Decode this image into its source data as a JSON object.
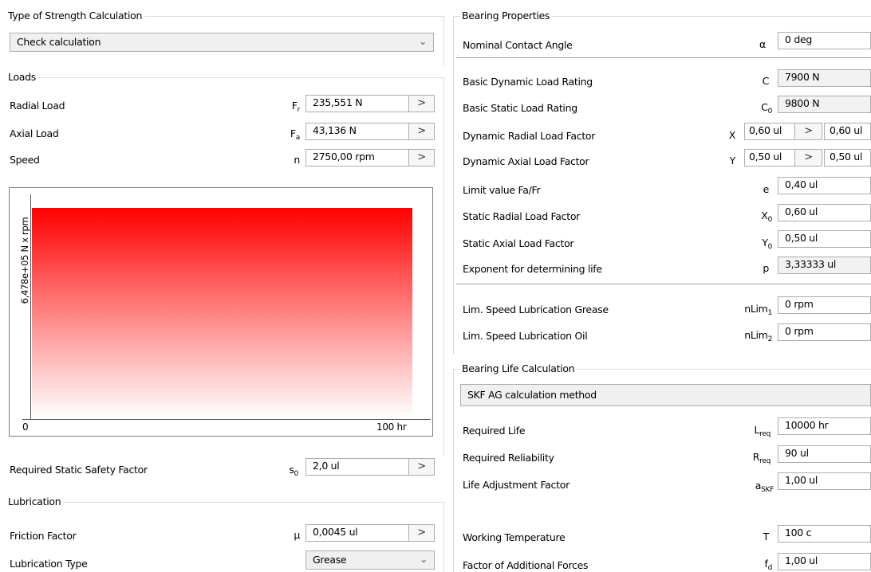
{
  "left": {
    "strength": {
      "title": "Type of Strength Calculation",
      "value": "Check calculation"
    },
    "loads": {
      "title": "Loads",
      "rows": [
        {
          "label": "Radial Load",
          "symbol": "F",
          "sub": "r",
          "value": "235,551 N"
        },
        {
          "label": "Axial Load",
          "symbol": "F",
          "sub": "a",
          "value": "43,136 N"
        },
        {
          "label": "Speed",
          "symbol": "n",
          "sub": "",
          "value": "2750,00 rpm"
        }
      ],
      "arrow": ">"
    },
    "chart": {
      "ylabel": "6,478e+05 N x rpm",
      "x_start": "0",
      "x_end": "100 hr"
    },
    "static_safety": {
      "label": "Required Static Safety Factor",
      "symbol": "s",
      "sub": "0",
      "value": "2,0 ul"
    },
    "lubrication": {
      "title": "Lubrication",
      "friction": {
        "label": "Friction Factor",
        "symbol": "μ",
        "value": "0,0045 ul"
      },
      "type": {
        "label": "Lubrication Type",
        "value": "Grease"
      }
    }
  },
  "right": {
    "bearing": {
      "title": "Bearing Properties",
      "contact": {
        "label": "Nominal Contact Angle",
        "symbol": "α",
        "value": "0 deg"
      },
      "dyn_rating": {
        "label": "Basic Dynamic Load Rating",
        "symbol": "C",
        "sub": "",
        "value": "7900 N"
      },
      "stat_rating": {
        "label": "Basic Static Load Rating",
        "symbol": "C",
        "sub": "0",
        "value": "9800 N"
      },
      "x_factor": {
        "label": "Dynamic Radial Load Factor",
        "symbol": "X",
        "value": "0,60 ul",
        "value2": "0,60 ul"
      },
      "y_factor": {
        "label": "Dynamic Axial Load Factor",
        "symbol": "Y",
        "value": "0,50 ul",
        "value2": "0,50 ul"
      },
      "limit": {
        "label": "Limit value Fa/Fr",
        "symbol": "e",
        "sub": "",
        "value": "0,40 ul"
      },
      "x0": {
        "label": "Static Radial Load Factor",
        "symbol": "X",
        "sub": "0",
        "value": "0,60 ul"
      },
      "y0": {
        "label": "Static Axial Load Factor",
        "symbol": "Y",
        "sub": "0",
        "value": "0,50 ul"
      },
      "exponent": {
        "label": "Exponent for determining life",
        "symbol": "p",
        "sub": "",
        "value": "3,33333 ul"
      },
      "grease": {
        "label": "Lim. Speed Lubrication Grease",
        "symbol": "nLim",
        "sub": "1",
        "value": "0 rpm"
      },
      "oil": {
        "label": "Lim. Speed Lubrication Oil",
        "symbol": "nLim",
        "sub": "2",
        "value": "0 rpm"
      }
    },
    "life": {
      "title": "Bearing Life Calculation",
      "method": "SKF AG calculation method",
      "req_life": {
        "label": "Required Life",
        "symbol": "L",
        "sub": "req",
        "value": "10000 hr"
      },
      "req_rel": {
        "label": "Required Reliability",
        "symbol": "R",
        "sub": "req",
        "value": "90 ul"
      },
      "adj": {
        "label": "Life Adjustment Factor",
        "symbol": "a",
        "sub": "SKF",
        "value": "1,00 ul"
      },
      "temp": {
        "label": "Working Temperature",
        "symbol": "T",
        "sub": "",
        "value": "100 c"
      },
      "add_forces": {
        "label": "Factor of Additional Forces",
        "symbol": "f",
        "sub": "d",
        "value": "1,00 ul"
      }
    }
  }
}
